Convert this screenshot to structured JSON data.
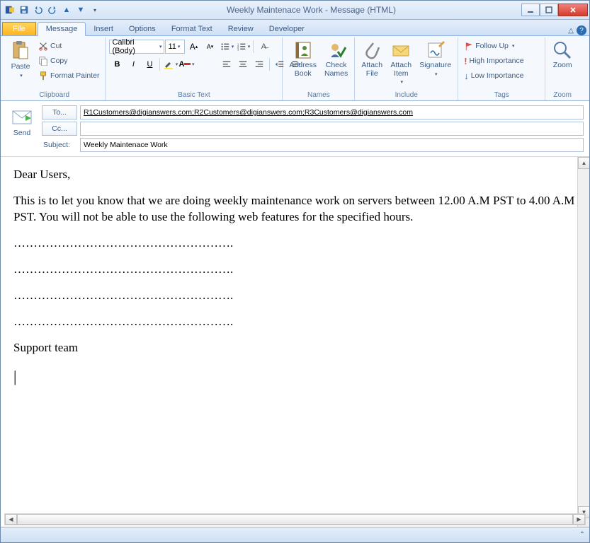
{
  "window": {
    "title": "Weekly Maintenace Work - Message (HTML)"
  },
  "tabs": {
    "file": "File",
    "items": [
      "Message",
      "Insert",
      "Options",
      "Format Text",
      "Review",
      "Developer"
    ],
    "active_index": 0
  },
  "ribbon": {
    "clipboard": {
      "title": "Clipboard",
      "paste": "Paste",
      "cut": "Cut",
      "copy": "Copy",
      "format_painter": "Format Painter"
    },
    "basic_text": {
      "title": "Basic Text",
      "font": "Calibri (Body)",
      "size": "11"
    },
    "names": {
      "title": "Names",
      "address_book": "Address\nBook",
      "check_names": "Check\nNames"
    },
    "include": {
      "title": "Include",
      "attach_file": "Attach\nFile",
      "attach_item": "Attach\nItem",
      "signature": "Signature"
    },
    "tags": {
      "title": "Tags",
      "follow_up": "Follow Up",
      "high": "High Importance",
      "low": "Low Importance"
    },
    "zoom": {
      "title": "Zoom",
      "zoom": "Zoom"
    }
  },
  "compose": {
    "send": "Send",
    "to_btn": "To...",
    "cc_btn": "Cc...",
    "subject_lbl": "Subject:",
    "to": "R1Customers@digianswers.com;R2Customers@digianswers.com;R3Customers@digianswers.com",
    "cc": "",
    "subject": "Weekly Maintenace Work"
  },
  "body": {
    "greeting": "Dear Users,",
    "para1": "This is to let you know that we are doing weekly maintenance work on servers between 12.00 A.M PST to 4.00 A.M PST. You will not be able to use the following web features for the specified hours.",
    "dots1": "……………………………………………….",
    "dots2": "……………………………………………….",
    "dots3": "……………………………………………….",
    "dots4": "……………………………………………….",
    "signoff": "Support team",
    "cursor": "|"
  }
}
